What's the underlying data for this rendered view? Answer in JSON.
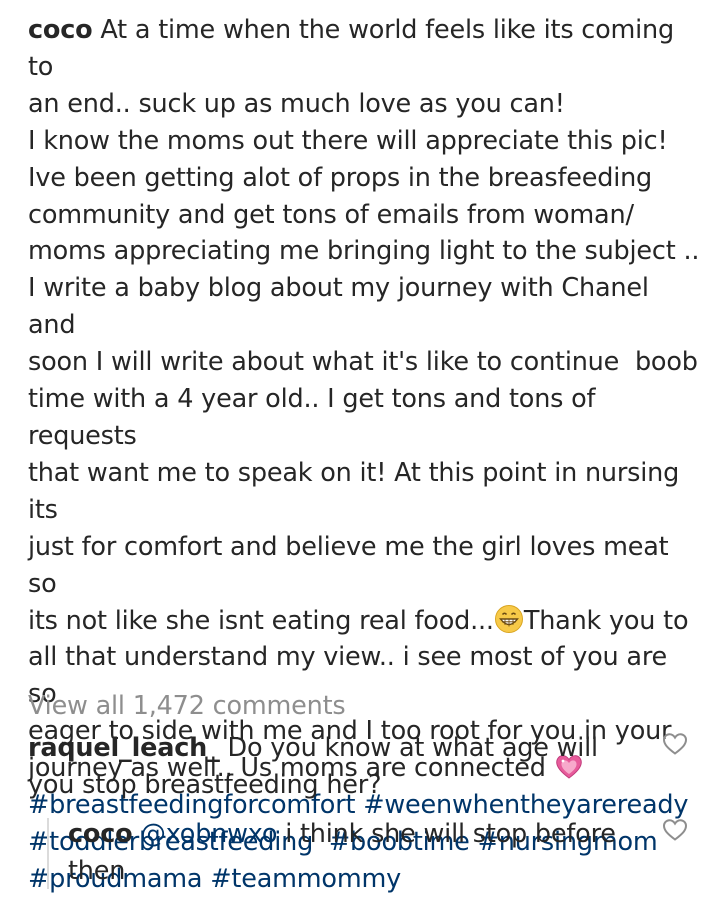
{
  "post": {
    "username": "coco",
    "caption_lines": [
      "At a time when the world feels like its coming to",
      "an end.. suck up as much love as you can!",
      "I know the moms out there will appreciate this pic!",
      "Ive been getting alot of props in the breasfeeding",
      "community and get tons of emails from woman/",
      "moms appreciating me bringing light to the subject ..",
      "I write a baby blog about my journey with Chanel and",
      "soon I will write about what it's like to continue  boob",
      "time with a 4 year old.. I get tons and tons of requests",
      "that want me to speak on it! At this point in nursing its",
      "just for comfort and believe me the girl loves meat so"
    ],
    "line_before_emoji": "its not like she isnt eating real food...",
    "grin_emoji": "grinning-face-emoji",
    "line_after_emoji": "Thank you to",
    "caption_lines_2": [
      "all that understand my view.. i see most of you are so",
      "eager to side with me and I too root for you in your"
    ],
    "line_before_heart": "journey as well.. Us moms are connected ",
    "heart_emoji": "sparkling-heart-emoji",
    "hashtags": [
      "#breastfeedingforcomfort",
      "#weenwhentheyareready",
      "#toddlerbreastfeeding",
      "#boobtime",
      "#nursingmom",
      "#proudmama",
      "#teammommy"
    ]
  },
  "view_all_comments": "View all 1,472 comments",
  "comments": [
    {
      "username": "raquel_leach_",
      "text": "Do you know at what age will you stop breastfeeding her?",
      "like_icon": "heart-outline-icon"
    },
    {
      "username": "coco",
      "mention": "@xobnwxo",
      "text": "i think she will stop before then",
      "like_icon": "heart-outline-icon"
    }
  ],
  "colors": {
    "text": "#262626",
    "link": "#003569",
    "muted": "#8e8e8e",
    "emoji_face": "#f7c948",
    "heart_pink": "#e75b9b"
  }
}
